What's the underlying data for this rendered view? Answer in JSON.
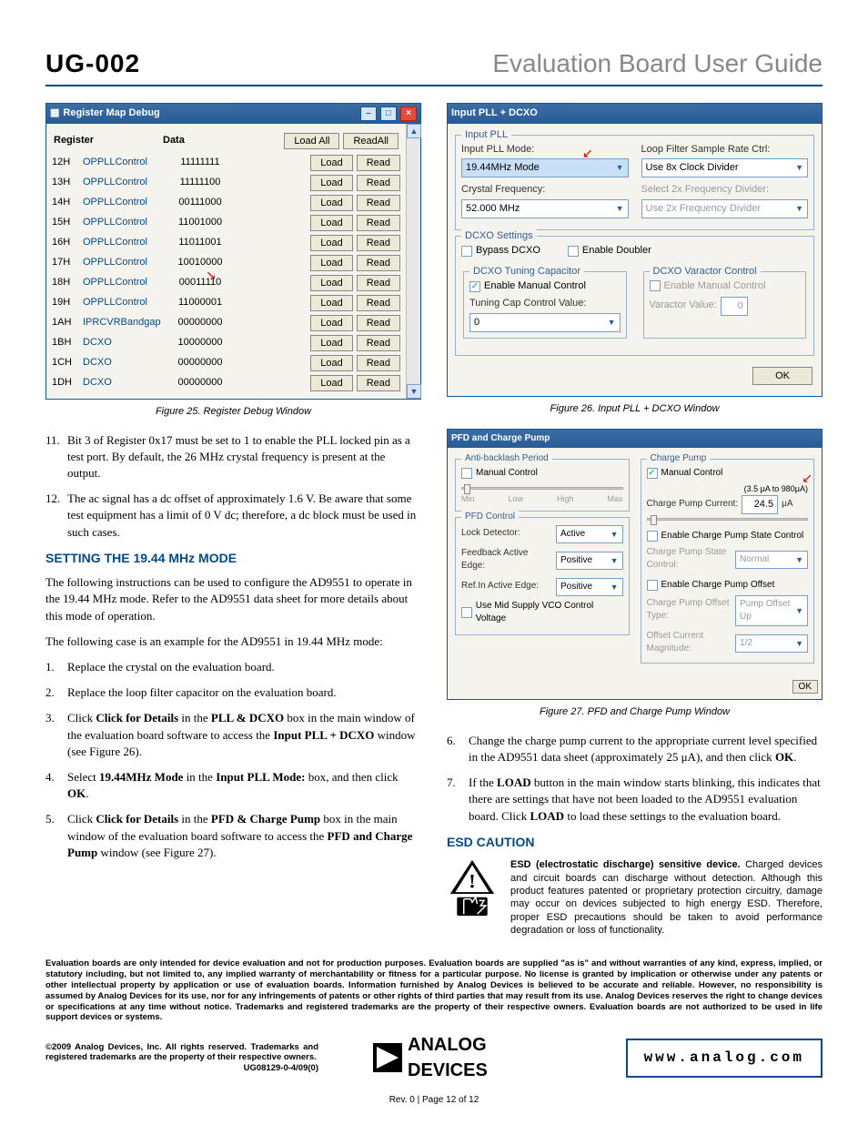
{
  "header": {
    "left": "UG-002",
    "right": "Evaluation Board User Guide"
  },
  "register_window": {
    "title": "Register Map Debug",
    "col_register": "Register",
    "col_data": "Data",
    "btn_loadall": "Load All",
    "btn_readall": "ReadAll",
    "btn_load": "Load",
    "btn_read": "Read",
    "rows": [
      {
        "addr": "12H",
        "name": "OPPLLControl",
        "data": "11111111"
      },
      {
        "addr": "13H",
        "name": "OPPLLControl",
        "data": "11111100"
      },
      {
        "addr": "14H",
        "name": "OPPLLControl",
        "data": "00111000"
      },
      {
        "addr": "15H",
        "name": "OPPLLControl",
        "data": "11001000"
      },
      {
        "addr": "16H",
        "name": "OPPLLControl",
        "data": "11011001"
      },
      {
        "addr": "17H",
        "name": "OPPLLControl",
        "data": "10010000"
      },
      {
        "addr": "18H",
        "name": "OPPLLControl",
        "data": "00011110"
      },
      {
        "addr": "19H",
        "name": "OPPLLControl",
        "data": "11000001"
      },
      {
        "addr": "1AH",
        "name": "IPRCVRBandgap",
        "data": "00000000"
      },
      {
        "addr": "1BH",
        "name": "DCXO",
        "data": "10000000"
      },
      {
        "addr": "1CH",
        "name": "DCXO",
        "data": "00000000"
      },
      {
        "addr": "1DH",
        "name": "DCXO",
        "data": "00000000"
      }
    ]
  },
  "captions": {
    "fig25": "Figure 25. Register Debug Window",
    "fig26": "Figure 26. Input PLL + DCXO Window",
    "fig27": "Figure 27. PFD and Charge Pump Window"
  },
  "list_top": [
    {
      "n": "11.",
      "t": "Bit 3 of Register 0x17 must be set to 1 to enable the PLL locked pin as a test port. By default, the 26 MHz crystal frequency is present at the output."
    },
    {
      "n": "12.",
      "t": "The ac signal has a dc offset of approximately 1.6 V. Be aware that some test equipment has a limit of 0 V dc; therefore, a dc block must be used in such cases."
    }
  ],
  "sect1": {
    "title": "SETTING THE 19.44 MHz MODE",
    "p1": "The following instructions can be used to configure the AD9551 to operate in the 19.44 MHz mode. Refer to the AD9551 data sheet for more details about this mode of operation.",
    "p2": "The following case is an example for the AD9551 in 19.44 MHz mode:"
  },
  "steps1": [
    {
      "n": "1.",
      "parts": [
        "Replace the crystal on the evaluation board."
      ]
    },
    {
      "n": "2.",
      "parts": [
        "Replace the loop filter capacitor on the evaluation board."
      ]
    },
    {
      "n": "3.",
      "parts": [
        "Click ",
        "<b>Click for Details</b>",
        " in the ",
        "<b>PLL & DCXO</b>",
        " box in the main window of the evaluation board software to access the ",
        "<b>Input PLL + DCXO</b>",
        " window (see Figure 26)."
      ]
    },
    {
      "n": "4.",
      "parts": [
        "Select ",
        "<b>19.44MHz Mode</b>",
        " in the ",
        "<b>Input PLL Mode:</b>",
        " box, and then click ",
        "<b>OK</b>",
        "."
      ]
    },
    {
      "n": "5.",
      "parts": [
        "Click ",
        "<b>Click for Details</b>",
        " in the ",
        "<b>PFD & Charge Pump</b>",
        " box in the main window of the evaluation board software to access the ",
        "<b>PFD and Charge Pump</b>",
        " window (see Figure 27)."
      ]
    }
  ],
  "dcxo_win": {
    "title": "Input PLL + DCXO",
    "grp_input": "Input PLL",
    "lbl_mode": "Input PLL Mode:",
    "val_mode": "19.44MHz Mode",
    "lbl_loop": "Loop Filter Sample Rate Ctrl:",
    "val_loop": "Use 8x Clock Divider",
    "lbl_xtal": "Crystal Frequency:",
    "val_xtal": "52.000 MHz",
    "lbl_div": "Select 2x Frequency Divider:",
    "val_div": "Use 2x Frequency Divider",
    "grp_dcxo": "DCXO Settings",
    "chk_bypass": "Bypass DCXO",
    "chk_doubler": "Enable Doubler",
    "grp_tune": "DCXO Tuning Capacitor",
    "chk_manual1": "Enable Manual Control",
    "lbl_tunecap": "Tuning Cap Control Value:",
    "val_tunecap": "0",
    "grp_varactor": "DCXO Varactor Control",
    "lbl_varactor": "Varactor Value:",
    "val_varactor": "0",
    "ok": "OK"
  },
  "pfd_win": {
    "title": "PFD and Charge Pump",
    "grp_anti": "Anti-backlash Period",
    "chk_manual": "Manual Control",
    "slider_labels": [
      "Min",
      "Low",
      "High",
      "Max"
    ],
    "grp_pfd": "PFD Control",
    "lbl_lock": "Lock Detector:",
    "val_lock": "Active",
    "lbl_fb": "Feedback Active Edge:",
    "val_fb": "Positive",
    "lbl_ref": "Ref.In Active Edge:",
    "val_ref": "Positive",
    "chk_midsup": "Use Mid Supply VCO Control Voltage",
    "grp_cp": "Charge Pump",
    "chk_cpmanual": "Manual Control",
    "lbl_cpcur": "Charge Pump Current:",
    "range_cp": "(3.5 μA to 980μA)",
    "val_cp": "24.5",
    "unit_cp": "μA",
    "chk_cpstate": "Enable Charge Pump State Control",
    "lbl_cpstatectl": "Charge Pump State Control:",
    "val_cpstatectl": "Normal",
    "chk_cpoffset": "Enable Charge Pump Offset",
    "lbl_cpofftype": "Charge Pump Offset Type:",
    "val_cpofftype": "Pump Offset Up",
    "lbl_offmag": "Offset Current Magnitude:",
    "val_offmag": "1/2",
    "ok": "OK"
  },
  "steps2": [
    {
      "n": "6.",
      "parts": [
        "Change the charge pump current to the appropriate current level specified in the AD9551 data sheet (approximately 25 μA), and then click ",
        "<b>OK</b>",
        "."
      ]
    },
    {
      "n": "7.",
      "parts": [
        "If the ",
        "<b>LOAD</b>",
        " button in the main window starts blinking, this indicates that there are settings that have not been loaded to the AD9551 evaluation board. Click ",
        "<b>LOAD</b>",
        " to load these settings to the evaluation board."
      ]
    }
  ],
  "esd": {
    "title": "ESD CAUTION",
    "heading": "ESD (electrostatic discharge) sensitive device.",
    "body": " Charged devices and circuit boards can discharge without detection. Although this product features patented or proprietary protection circuitry, damage may occur on devices subjected to high energy ESD. Therefore, proper ESD precautions should be taken to avoid performance degradation or loss of functionality."
  },
  "legal": "Evaluation boards are only intended for device evaluation and not for production purposes. Evaluation boards are supplied \"as is\" and without warranties of any kind, express, implied, or statutory including, but not limited to, any implied warranty of merchantability or fitness for a particular purpose. No license is granted by implication or otherwise under any patents or other intellectual property by application or use of evaluation boards. Information furnished by Analog Devices is believed to be accurate and reliable. However, no responsibility is assumed by Analog Devices for its use, nor for any infringements of patents or other rights of third parties that may result from its use. Analog Devices reserves the right to change devices or specifications at any time without notice. Trademarks and registered trademarks are the property of their respective owners. Evaluation boards are not authorized to be used in life support devices or systems.",
  "copy": {
    "line1": "©2009 Analog Devices, Inc. All rights reserved. Trademarks and registered trademarks are the property of their respective owners.",
    "code": "UG08129-0-4/09(0)"
  },
  "logo": {
    "top": "ANALOG",
    "bot": "DEVICES"
  },
  "www": "www.analog.com",
  "pagenum": "Rev. 0 | Page 12 of 12"
}
